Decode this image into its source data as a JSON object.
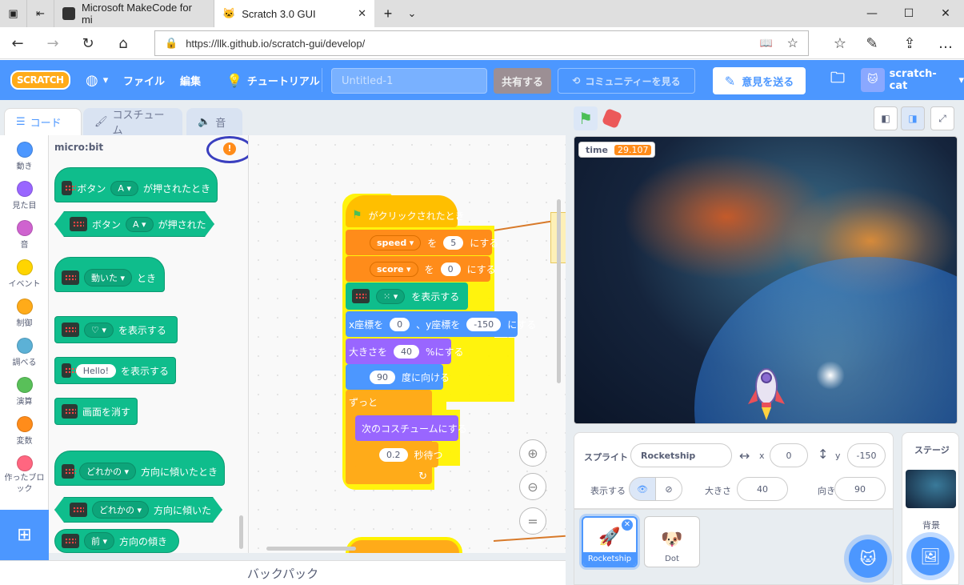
{
  "browser": {
    "tabs": [
      {
        "title": "Microsoft MakeCode for mi"
      },
      {
        "title": "Scratch 3.0 GUI"
      }
    ],
    "url": "https://llk.github.io/scratch-gui/develop/"
  },
  "menu": {
    "logo": "SCRATCH",
    "file": "ファイル",
    "edit": "編集",
    "tutorials": "チュートリアル",
    "project_title_placeholder": "Untitled-1",
    "share": "共有する",
    "community": "コミュニティーを見る",
    "feedback": "意見を送る",
    "username": "scratch-cat"
  },
  "editor_tabs": {
    "code": "コード",
    "costumes": "コスチューム",
    "sounds": "音"
  },
  "categories": [
    {
      "label": "動き",
      "color": "#4c97ff"
    },
    {
      "label": "見た目",
      "color": "#9966ff"
    },
    {
      "label": "音",
      "color": "#cf63cf"
    },
    {
      "label": "イベント",
      "color": "#ffd500"
    },
    {
      "label": "制御",
      "color": "#ffab19"
    },
    {
      "label": "調べる",
      "color": "#5cb1d6"
    },
    {
      "label": "演算",
      "color": "#59c059"
    },
    {
      "label": "変数",
      "color": "#ff8c1a"
    },
    {
      "label": "作ったブロック",
      "color": "#ff6680"
    }
  ],
  "flyout": {
    "heading": "micro:bit",
    "blocks": {
      "when_button": {
        "a": "ボタン",
        "dd": "A",
        "b": "が押されたとき"
      },
      "button_pressed": {
        "a": "ボタン",
        "dd": "A",
        "b": "が押された"
      },
      "when_moved": {
        "dd": "動いた",
        "b": "とき"
      },
      "display_pattern": {
        "b": "を表示する"
      },
      "display_text": {
        "val": "Hello!",
        "b": "を表示する"
      },
      "clear": {
        "a": "画面を消す"
      },
      "when_tilted": {
        "dd": "どれかの",
        "b": "方向に傾いたとき"
      },
      "is_tilted": {
        "dd": "どれかの",
        "b": "方向に傾いた"
      },
      "tilt_angle": {
        "dd": "前",
        "b": "方向の傾き"
      }
    }
  },
  "script": {
    "when_flag": "がクリックされたとき",
    "set1": {
      "var": "speed",
      "a": "を",
      "val": "5",
      "b": "にする"
    },
    "set2": {
      "var": "score",
      "a": "を",
      "val": "0",
      "b": "にする"
    },
    "display": {
      "b": "を表示する"
    },
    "goto": {
      "a": "x座標を",
      "x": "0",
      "b": "、y座標を",
      "y": "-150",
      "c": "にする"
    },
    "size": {
      "a": "大きさを",
      "val": "40",
      "b": "%にする"
    },
    "point": {
      "val": "90",
      "b": "度に向ける"
    },
    "forever": "ずっと",
    "next_costume": "次のコスチュームにする",
    "wait": {
      "val": "0.2",
      "b": "秒待つ"
    }
  },
  "backpack": "バックパック",
  "stage": {
    "monitor_label": "time",
    "monitor_value": "29.107"
  },
  "sprite_info": {
    "sprite_label": "スプライト",
    "sprite_name": "Rocketship",
    "x_label": "x",
    "x": "0",
    "y_label": "y",
    "y": "-150",
    "show_label": "表示する",
    "size_label": "大きさ",
    "size": "40",
    "direction_label": "向き",
    "direction": "90"
  },
  "sprites": [
    {
      "name": "Rocketship",
      "selected": true
    },
    {
      "name": "Dot",
      "selected": false
    }
  ],
  "stage_panel": {
    "title": "ステージ",
    "backdrop_label": "背景"
  }
}
